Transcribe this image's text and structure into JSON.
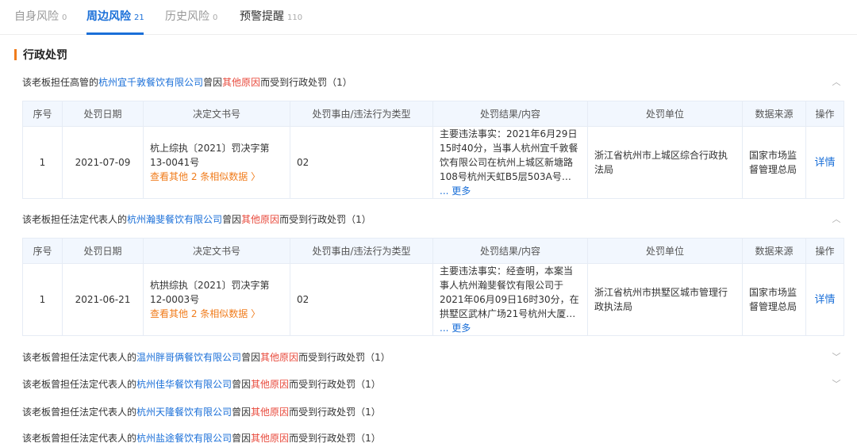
{
  "tabs": [
    {
      "label": "自身风险",
      "count": "0"
    },
    {
      "label": "周边风险",
      "count": "21"
    },
    {
      "label": "历史风险",
      "count": "0"
    },
    {
      "label": "预警提醒",
      "count": "110"
    }
  ],
  "section": {
    "title": "行政处罚"
  },
  "columns": [
    "序号",
    "处罚日期",
    "决定文书号",
    "处罚事由/违法行为类型",
    "处罚结果/内容",
    "处罚单位",
    "数据来源",
    "操作"
  ],
  "records": [
    {
      "prefix": "该老板担任高管的",
      "company": "杭州宜千敦餐饮有限公司",
      "mid": "曾因",
      "reason": "其他原因",
      "suffix": "而受到行政处罚",
      "count": "（1）",
      "chevron": "︿",
      "row": {
        "no": "1",
        "date": "2021-07-09",
        "doc_no": "杭上综执〔2021〕罚决字第13-0041号",
        "similar": "查看其他 2 条相似数据 〉",
        "cause": "02",
        "result": "主要违法事实：2021年6月29日15时40分，当事人杭州宜千敦餐饮有限公司在杭州上城区新塘路108号杭州天虹B5层503A号…",
        "more": "... 更多",
        "unit": "浙江省杭州市上城区综合行政执法局",
        "source": "国家市场监督管理总局",
        "action": "详情"
      }
    },
    {
      "prefix": "该老板担任法定代表人的",
      "company": "杭州瀚斐餐饮有限公司",
      "mid": "曾因",
      "reason": "其他原因",
      "suffix": "而受到行政处罚",
      "count": "（1）",
      "chevron": "︿",
      "row": {
        "no": "1",
        "date": "2021-06-21",
        "doc_no": "杭拱综执〔2021〕罚决字第12-0003号",
        "similar": "查看其他 2 条相似数据 〉",
        "cause": "02",
        "result": "主要违法事实：经查明，本案当事人杭州瀚斐餐饮有限公司于2021年06月09日16时30分，在拱墅区武林广场21号杭州大厦…",
        "more": "... 更多",
        "unit": "浙江省杭州市拱墅区城市管理行政执法局",
        "source": "国家市场监督管理总局",
        "action": "详情"
      }
    },
    {
      "prefix": "该老板曾担任法定代表人的",
      "company": "温州胖哥俩餐饮有限公司",
      "mid": "曾因",
      "reason": "其他原因",
      "suffix": "而受到行政处罚",
      "count": "（1）",
      "chevron": "﹀"
    },
    {
      "prefix": "该老板曾担任法定代表人的",
      "company": "杭州佳华餐饮有限公司",
      "mid": "曾因",
      "reason": "其他原因",
      "suffix": "而受到行政处罚",
      "count": "（1）",
      "chevron": "﹀"
    },
    {
      "prefix": "该老板曾担任法定代表人的",
      "company": "杭州天隆餐饮有限公司",
      "mid": "曾因",
      "reason": "其他原因",
      "suffix": "而受到行政处罚",
      "count": "（1）",
      "chevron": ""
    },
    {
      "prefix": "该老板曾担任法定代表人的",
      "company": "杭州盐途餐饮有限公司",
      "mid": "曾因",
      "reason": "其他原因",
      "suffix": "而受到行政处罚",
      "count": "（1）",
      "chevron": ""
    }
  ],
  "colors": {
    "accent": "#1a6fd8",
    "orange": "#f07c1c",
    "red": "#e84a3c",
    "header_bg": "#f2f7fe"
  }
}
